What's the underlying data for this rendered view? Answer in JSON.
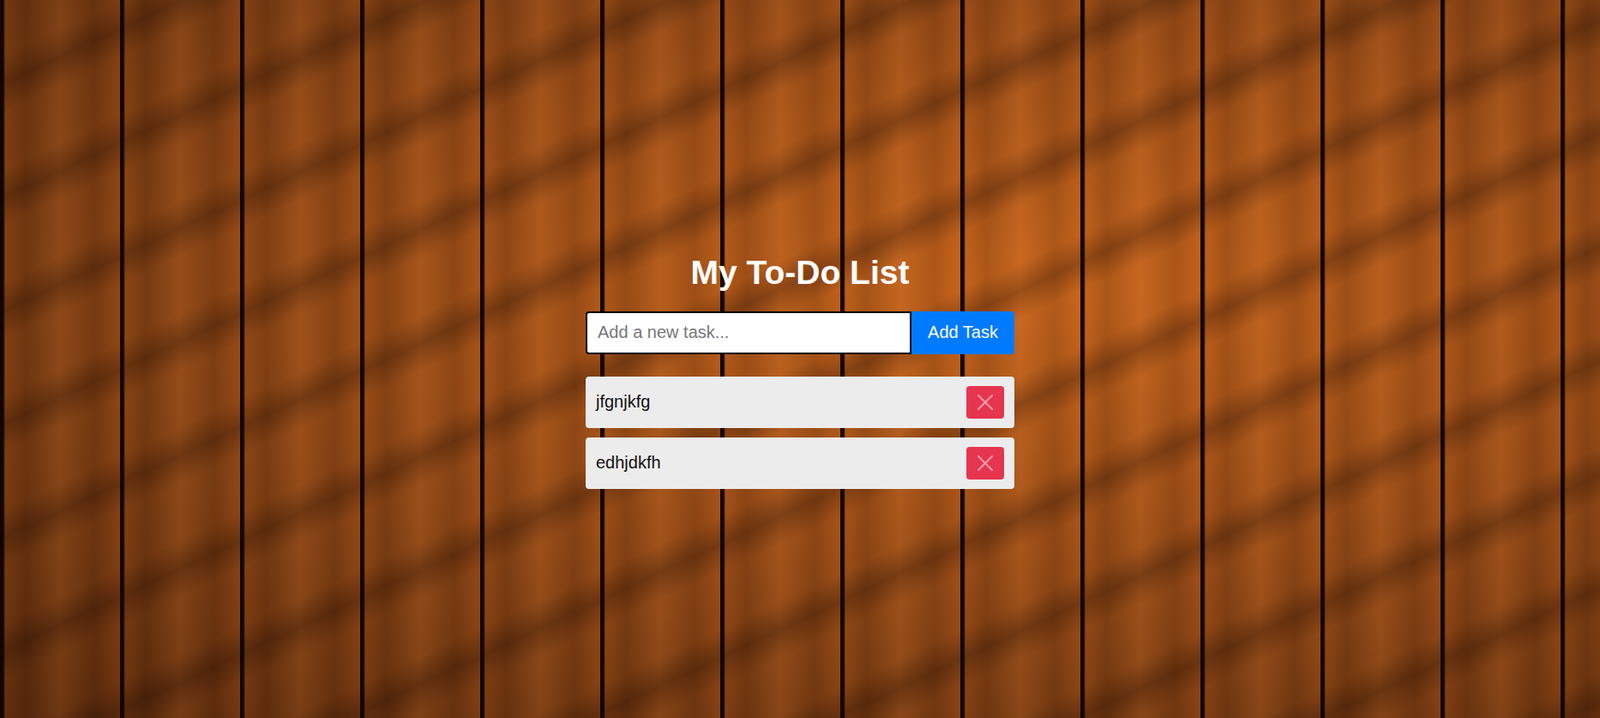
{
  "app": {
    "title": "My To-Do List"
  },
  "input": {
    "placeholder": "Add a new task...",
    "value": "",
    "focused": true
  },
  "add_button": "Add Task",
  "tasks": [
    {
      "text": "jfgnjkfg"
    },
    {
      "text": "edhjdkfh"
    }
  ]
}
